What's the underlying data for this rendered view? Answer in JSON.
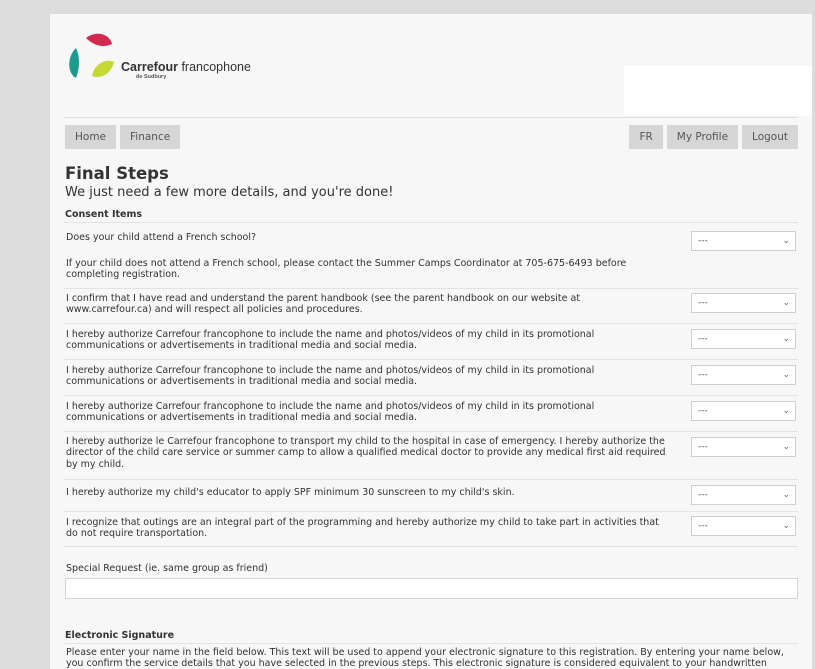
{
  "brand": {
    "name_bold": "Carrefour",
    "name_rest": " francophone",
    "sub": "de Sudbury"
  },
  "nav": {
    "home": "Home",
    "finance": "Finance",
    "lang": "FR",
    "profile": "My Profile",
    "logout": "Logout"
  },
  "page": {
    "title": "Final Steps",
    "subtitle": "We just need a few more details, and you're done!"
  },
  "consent": {
    "heading": "Consent Items",
    "select_value": "---",
    "items": [
      "Does your child attend a French school?",
      "If your child does not attend a French school, please contact the Summer Camps Coordinator at 705-675-6493 before completing registration.",
      "I confirm that I have read and understand the parent handbook (see the parent handbook on our website at www.carrefour.ca) and will respect all policies and procedures.",
      "I hereby authorize Carrefour francophone to include the name and photos/videos of my child in its promotional communications or advertisements in traditional media and social media.",
      "I hereby authorize Carrefour francophone to include the name and photos/videos of my child in its promotional communications or advertisements in traditional media and social media.",
      "I hereby authorize Carrefour francophone to include the name and photos/videos of my child in its promotional communications or advertisements in traditional media and social media.",
      "I hereby authorize le Carrefour francophone to transport my child to the hospital in case of emergency. I hereby authorize the director of the child care service or summer camp to allow a qualified medical doctor to provide any medical first aid required by my child.",
      "I hereby authorize my child's educator to apply SPF minimum 30 sunscreen to my child's skin.",
      "I recognize that outings are an integral part of the programming and hereby authorize my child to take part in activities that do not require transportation."
    ]
  },
  "special_request": {
    "label": "Special Request (ie. same group as friend)",
    "value": ""
  },
  "esig": {
    "heading": "Electronic Signature",
    "text": "Please enter your name in the field below. This text will be used to append your electronic signature to this registration. By entering your name below, you confirm the service details that you have selected in the previous steps. This electronic signature is considered equivalent to your handwritten"
  },
  "colors": {
    "logo_red": "#d2294f",
    "logo_teal": "#1b9a8e",
    "logo_green": "#c6d836",
    "nav_bg": "#d6d6d6"
  }
}
